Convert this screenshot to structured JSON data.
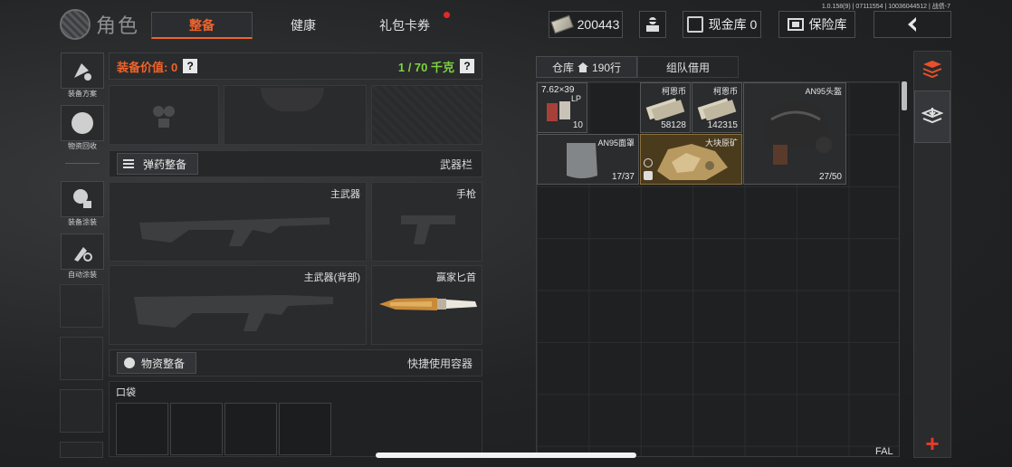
{
  "version": "1.0.158(9) | 07111554 | 10036044512 | 战债-7",
  "header": {
    "title": "角色",
    "tabs": [
      {
        "label": "整备",
        "active": true
      },
      {
        "label": "健康",
        "active": false
      },
      {
        "label": "礼包卡券",
        "active": false,
        "badge": true
      }
    ],
    "currency": "200443",
    "cash_vault": "现金库 0",
    "safe_box": "保险库",
    "accent_color": "#f0632b"
  },
  "left_menu": [
    {
      "label": "装备方案",
      "icon": "loadout-icon"
    },
    {
      "label": "物资回收",
      "icon": "recycle-icon"
    },
    {
      "label": "装备涂装",
      "icon": "skin-icon"
    },
    {
      "label": "自动涂装",
      "icon": "auto-paint-icon"
    }
  ],
  "equipment": {
    "value_label": "装备价值: 0",
    "weight_label": "1 / 70 千克",
    "ammo_button": "弹药整备",
    "weapon_bar": "武器栏",
    "primary_weapon": "主武器",
    "pistol": "手枪",
    "primary_weapon_back": "主武器(背部)",
    "melee": "赢家匕首",
    "supply_button": "物资整备",
    "quick_container": "快捷使用容器",
    "pocket": "口袋"
  },
  "stash": {
    "tab_label": "仓库",
    "rows": "190行",
    "team_tab": "组队借用",
    "items": [
      {
        "name": "7.62×39",
        "sub": "LP",
        "count": "10"
      },
      {
        "name": "柯恩币",
        "count": "58128"
      },
      {
        "name": "柯恩币",
        "count": "142315"
      },
      {
        "name": "AN95头盔",
        "count": "27/50"
      },
      {
        "name": "AN95面罩",
        "count": "17/37"
      },
      {
        "name": "大块原矿",
        "count": ""
      }
    ],
    "bottom_label": "FAL"
  }
}
